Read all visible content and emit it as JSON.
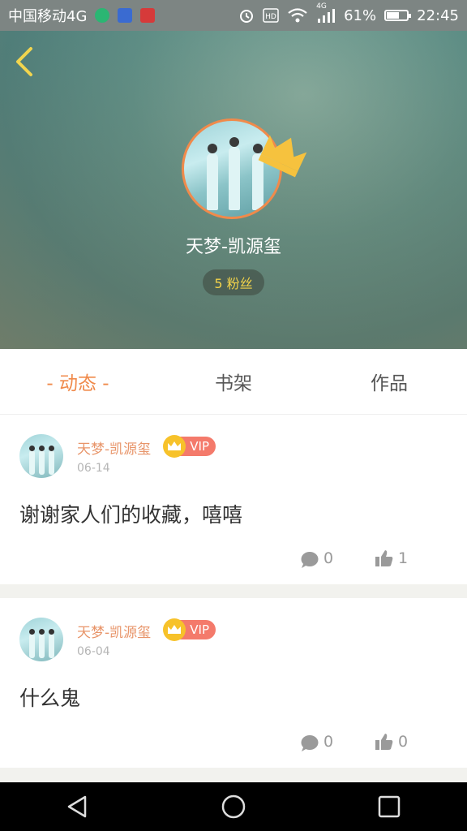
{
  "status_bar": {
    "carrier": "中国移动4G",
    "net_small": "4G",
    "battery": "61%",
    "battery_level": 0.61,
    "time": "22:45"
  },
  "profile": {
    "username": "天梦-凯源玺",
    "fans": "5 粉丝"
  },
  "tabs": [
    {
      "label": "- 动态 -",
      "active": true
    },
    {
      "label": "书架",
      "active": false
    },
    {
      "label": "作品",
      "active": false
    }
  ],
  "posts": [
    {
      "author": "天梦-凯源玺",
      "vip": "VIP",
      "date": "06-14",
      "content": "谢谢家人们的收藏，嘻嘻",
      "comments": "0",
      "likes": "1"
    },
    {
      "author": "天梦-凯源玺",
      "vip": "VIP",
      "date": "06-04",
      "content": "什么鬼",
      "comments": "0",
      "likes": "0"
    }
  ],
  "colors": {
    "accent": "#f08a4b",
    "vip": "#f47a6b",
    "fans_text": "#f3d34a"
  }
}
